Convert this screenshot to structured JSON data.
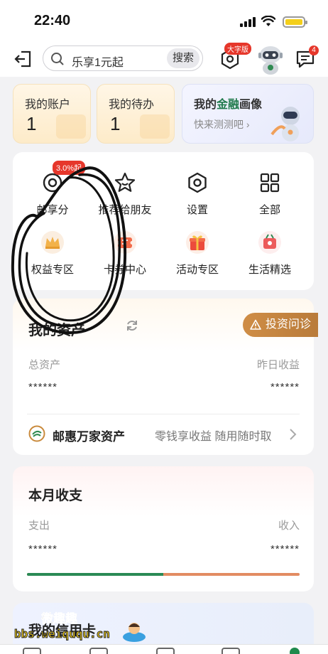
{
  "status_bar": {
    "time": "22:40"
  },
  "header": {
    "search": {
      "text": "乐享1元起",
      "button": "搜索"
    },
    "big_font_badge": "大字版",
    "message_count": "4"
  },
  "quick_cards": [
    {
      "title": "我的账户",
      "value": "1"
    },
    {
      "title": "我的待办",
      "value": "1"
    }
  ],
  "profile_card": {
    "title_a": "我的",
    "title_hl": "金融",
    "title_b": "画像",
    "subtitle": "快来测测吧"
  },
  "menu": {
    "rate_badge": "3.0%起",
    "items": [
      {
        "label": "邮享分",
        "icon": "points-icon"
      },
      {
        "label": "推荐给朋友",
        "icon": "star-icon"
      },
      {
        "label": "设置",
        "icon": "settings-icon"
      },
      {
        "label": "全部",
        "icon": "grid-icon"
      },
      {
        "label": "权益专区",
        "icon": "crown-icon"
      },
      {
        "label": "卡券中心",
        "icon": "coupon-icon"
      },
      {
        "label": "活动专区",
        "icon": "gift-icon"
      },
      {
        "label": "生活精选",
        "icon": "life-icon"
      }
    ]
  },
  "assets": {
    "title": "我的资产",
    "invest_button": "投资问诊",
    "total_label": "总资产",
    "total_value": "******",
    "yesterday_label": "昨日收益",
    "yesterday_value": "******",
    "youhui_title": "邮惠万家资产",
    "youhui_sub": "零钱享收益 随用随时取"
  },
  "income": {
    "title": "本月收支",
    "expense_label": "支出",
    "expense_value": "******",
    "income_label": "收入",
    "income_value": "******",
    "expense_share": 0.5
  },
  "card_section": {
    "title": "我的信用卡"
  },
  "watermark": {
    "top": "微趣趣",
    "bottom": "bbs.weiququ.cn"
  },
  "colors": {
    "accent_green": "#1f7a4c",
    "badge_red": "#e6372b",
    "invest_gold": "#c4843f",
    "expense_bar": "#2a8a55",
    "income_bar": "#e28c62"
  }
}
